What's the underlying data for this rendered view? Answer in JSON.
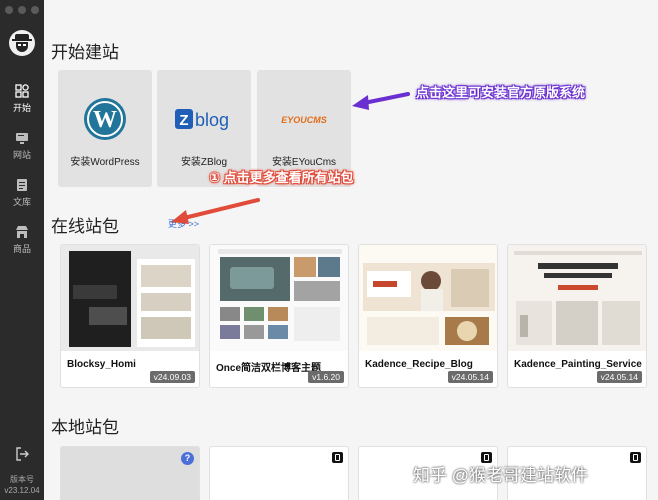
{
  "sidebar": {
    "items": [
      {
        "label": "开始",
        "icon": "grid-icon",
        "active": true
      },
      {
        "label": "网站",
        "icon": "monitor-icon",
        "active": false
      },
      {
        "label": "文库",
        "icon": "document-icon",
        "active": false
      },
      {
        "label": "商品",
        "icon": "store-icon",
        "active": false
      }
    ],
    "version_label": "版本号",
    "version": "v23.12.04"
  },
  "main": {
    "start_title": "开始建站",
    "install_cards": [
      {
        "label": "安装WordPress",
        "logo_text": "W"
      },
      {
        "label": "安装ZBlog",
        "logo_text": "blog"
      },
      {
        "label": "安装EYouCms",
        "logo_text": "EYOUCMS"
      }
    ],
    "online_title": "在线站包",
    "more_label": "更多 >>",
    "online_packages": [
      {
        "name": "Blocksy_Homi",
        "version": "v24.09.03"
      },
      {
        "name": "Once简洁双栏博客主题",
        "version": "v1.6.20"
      },
      {
        "name": "Kadence_Recipe_Blog",
        "version": "v24.05.14"
      },
      {
        "name": "Kadence_Painting_Service",
        "version": "v24.05.14"
      }
    ],
    "local_title": "本地站包"
  },
  "annotations": {
    "official": "点击这里可安装官方原版系统",
    "more": "① 点击更多查看所有站包"
  },
  "watermark": "知乎 @猴老哥建站软件",
  "colors": {
    "sidebar": "#2b2b2b",
    "arrow_purple": "#6a2fd0",
    "arrow_red": "#e04b3a",
    "link": "#3b6ed8"
  }
}
